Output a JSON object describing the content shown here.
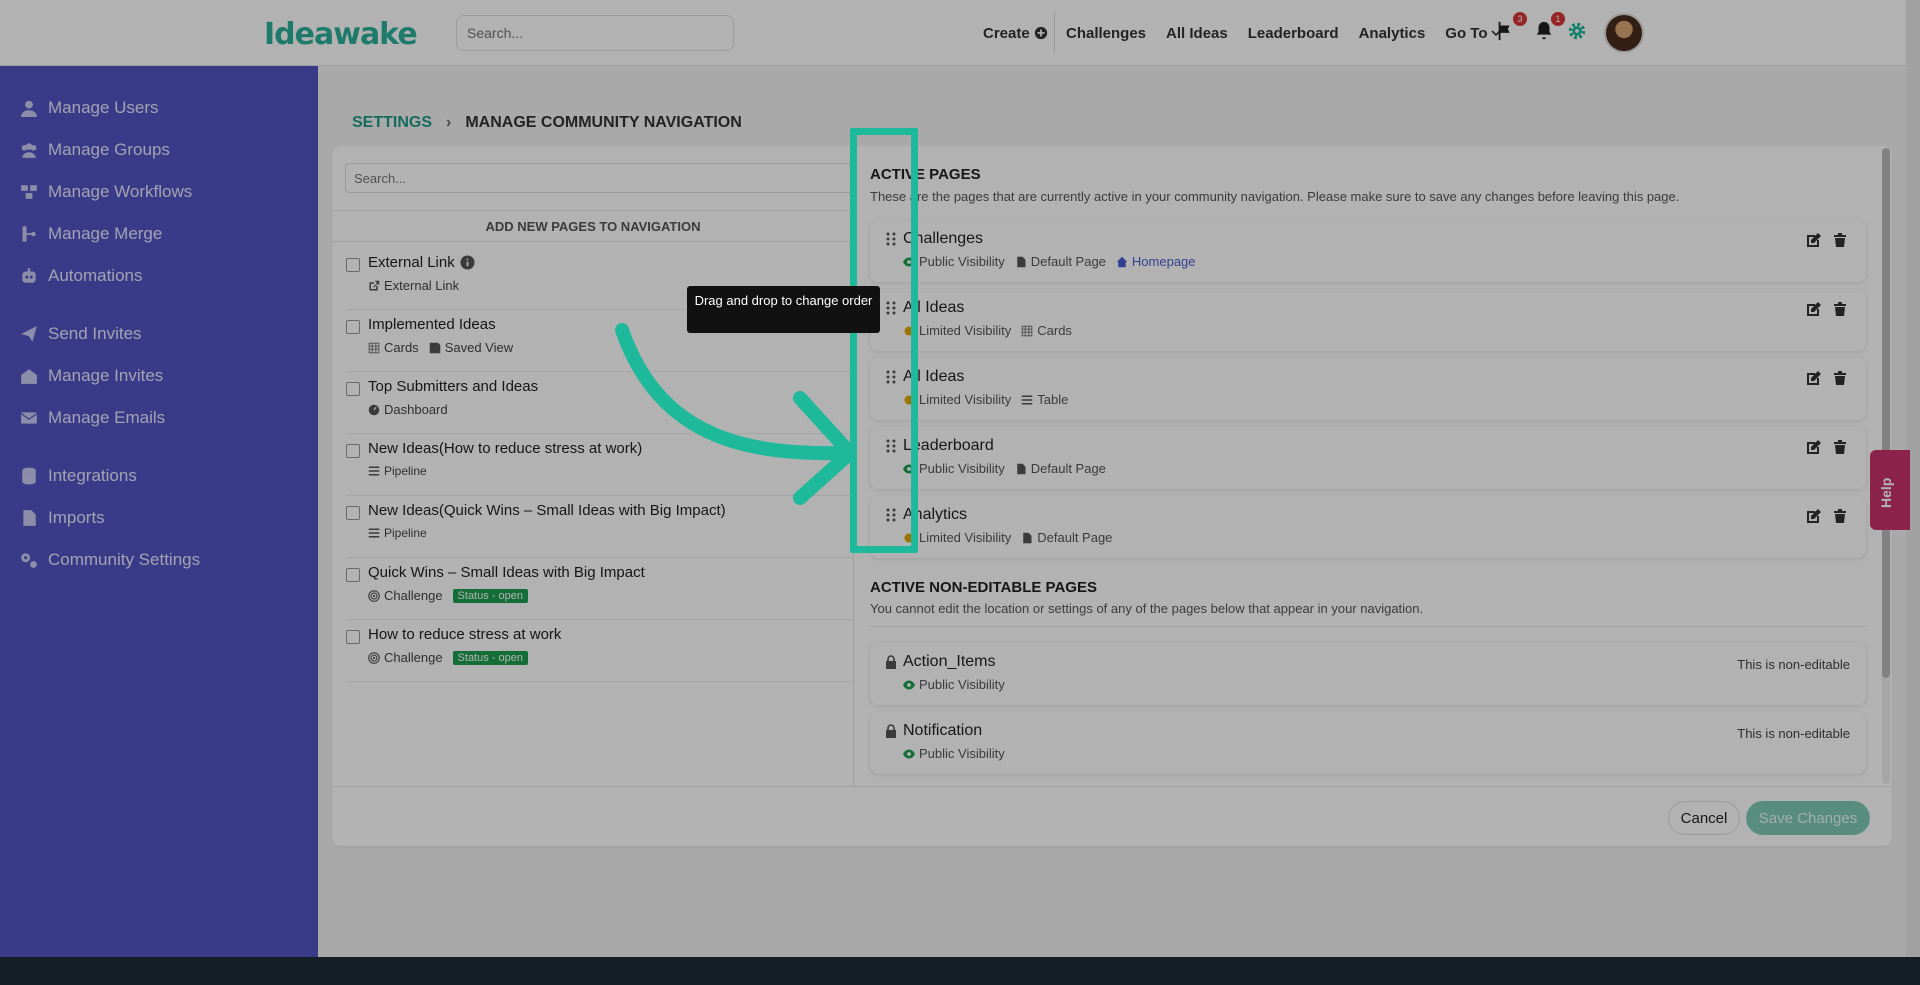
{
  "topbar": {
    "logo_text": "Ideawake",
    "search_placeholder": "Search...",
    "nav": [
      "Create",
      "Challenges",
      "All Ideas",
      "Leaderboard",
      "Analytics",
      "Go To"
    ],
    "flag_count": "3",
    "bell_count": "1"
  },
  "sidebar": {
    "items": [
      {
        "label": "Manage Users",
        "icon": "user-icon"
      },
      {
        "label": "Manage Groups",
        "icon": "users-icon"
      },
      {
        "label": "Manage Workflows",
        "icon": "workflow-icon"
      },
      {
        "label": "Manage Merge",
        "icon": "merge-icon"
      },
      {
        "label": "Automations",
        "icon": "robot-icon"
      },
      {
        "label": "Send Invites",
        "icon": "send-icon"
      },
      {
        "label": "Manage Invites",
        "icon": "invite-icon"
      },
      {
        "label": "Manage Emails",
        "icon": "envelope-icon"
      },
      {
        "label": "Integrations",
        "icon": "database-icon"
      },
      {
        "label": "Imports",
        "icon": "file-icon"
      },
      {
        "label": "Community Settings",
        "icon": "gears-icon"
      }
    ]
  },
  "breadcrumb": {
    "root": "SETTINGS",
    "current": "MANAGE COMMUNITY NAVIGATION"
  },
  "left_panel": {
    "search_placeholder": "Search...",
    "heading": "ADD NEW PAGES TO NAVIGATION",
    "items": [
      {
        "title": "External Link",
        "meta": [
          {
            "icon": "external-link-icon",
            "text": "External Link"
          }
        ]
      },
      {
        "title": "Implemented Ideas",
        "meta": [
          {
            "icon": "grid-icon",
            "text": "Cards"
          },
          {
            "icon": "save-icon",
            "text": "Saved View"
          }
        ]
      },
      {
        "title": "Top Submitters and Ideas",
        "meta": [
          {
            "icon": "dashboard-icon",
            "text": "Dashboard"
          }
        ]
      },
      {
        "title": "New Ideas(How to reduce stress at work)",
        "meta": [
          {
            "icon": "list-icon",
            "text": "Pipeline"
          }
        ]
      },
      {
        "title": "New Ideas(Quick Wins – Small Ideas with Big Impact)",
        "meta": [
          {
            "icon": "list-icon",
            "text": "Pipeline"
          }
        ]
      },
      {
        "title": "Quick Wins – Small Ideas with Big Impact",
        "meta": [
          {
            "icon": "target-icon",
            "text": "Challenge"
          }
        ],
        "status": "Status - open"
      },
      {
        "title": "How to reduce stress at work",
        "meta": [
          {
            "icon": "target-icon",
            "text": "Challenge"
          }
        ],
        "status": "Status - open"
      }
    ]
  },
  "active_pages": {
    "title": "ACTIVE PAGES",
    "description": "These are the pages that are currently active in your community navigation. Please make sure to save any changes before leaving this page.",
    "items": [
      {
        "name": "Challenges",
        "visibility": "Public Visibility",
        "meta": [
          {
            "icon": "file-icon",
            "text": "Default Page"
          }
        ],
        "extra": "Homepage"
      },
      {
        "name": "All Ideas",
        "visibility": "Limited Visibility",
        "meta": [
          {
            "icon": "grid-icon",
            "text": "Cards"
          }
        ]
      },
      {
        "name": "All Ideas",
        "visibility": "Limited Visibility",
        "meta": [
          {
            "icon": "list-icon",
            "text": "Table"
          }
        ]
      },
      {
        "name": "Leaderboard",
        "visibility": "Public Visibility",
        "meta": [
          {
            "icon": "file-icon",
            "text": "Default Page"
          }
        ]
      },
      {
        "name": "Analytics",
        "visibility": "Limited Visibility",
        "meta": [
          {
            "icon": "file-icon",
            "text": "Default Page"
          }
        ]
      }
    ]
  },
  "non_editable": {
    "title": "ACTIVE NON-EDITABLE PAGES",
    "description": "You cannot edit the location or settings of any of the pages below that appear in your navigation.",
    "items": [
      {
        "name": "Action_Items",
        "visibility": "Public Visibility",
        "note": "This is non-editable"
      },
      {
        "name": "Notification",
        "visibility": "Public Visibility",
        "note": "This is non-editable"
      }
    ]
  },
  "buttons": {
    "cancel": "Cancel",
    "save": "Save Changes"
  },
  "help_label": "Help",
  "tooltip": "Drag and drop to change order",
  "colors": {
    "accent": "#1db99a",
    "sidebar": "#5355c3",
    "public": "#1e9e4f",
    "limited": "#e0a800",
    "link": "#4a5bd0"
  }
}
